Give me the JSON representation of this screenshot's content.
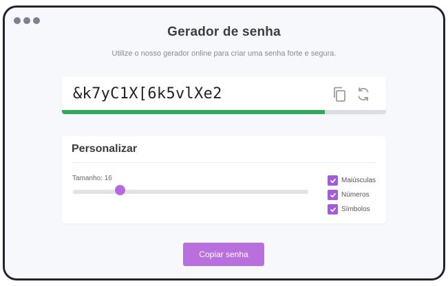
{
  "app": {
    "title": "Gerador de senha",
    "subtitle": "Utilize o nosso gerador online para criar uma senha forte e segura."
  },
  "password": {
    "value": "&k7yC1X[6k5vlXe2",
    "strength_fraction": 0.81,
    "strength_color": "#31a95a",
    "copy_icon": "copy-icon",
    "refresh_icon": "refresh-icon"
  },
  "customize": {
    "title": "Personalizar",
    "length_label": "Tamanho: 16",
    "length_slider_fraction": 0.2,
    "options": [
      {
        "label": "Maiúsculas",
        "checked": true
      },
      {
        "label": "Números",
        "checked": true
      },
      {
        "label": "Símbolos",
        "checked": true
      }
    ]
  },
  "actions": {
    "copy_label": "Copiar senha"
  },
  "colors": {
    "accent": "#b96fde",
    "checkbox": "#a55ad8",
    "window_border": "#1f2230",
    "window_bg": "#f7f8fb"
  }
}
